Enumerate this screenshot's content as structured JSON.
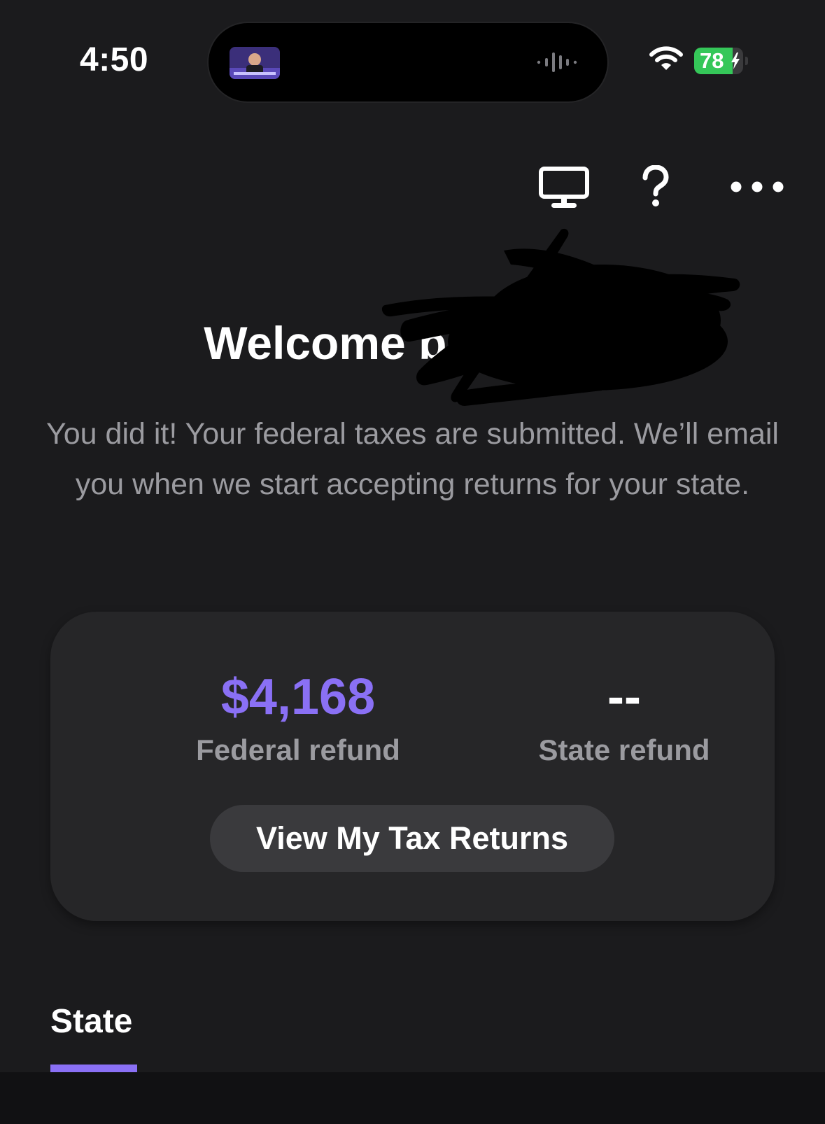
{
  "status_bar": {
    "time": "4:50",
    "battery_level": "78",
    "battery_fraction": 0.78
  },
  "toolbar": {
    "icons": [
      "desktop-icon",
      "help-icon",
      "more-icon"
    ]
  },
  "greeting": {
    "title": "Welcome back, go!",
    "message": "You did it! Your federal taxes are submitted. We’ll email you when we start accepting returns for your state."
  },
  "refund_card": {
    "federal_amount": "$4,168",
    "federal_label": "Federal refund",
    "state_amount": "--",
    "state_label": "State refund",
    "button_label": "View My Tax Returns"
  },
  "tabs": [
    {
      "label": "State",
      "active": true
    }
  ],
  "colors": {
    "background": "#1b1b1d",
    "card": "#262628",
    "accent": "#8a70f5",
    "muted_text": "#9b9ba0",
    "battery_green": "#35c759"
  }
}
